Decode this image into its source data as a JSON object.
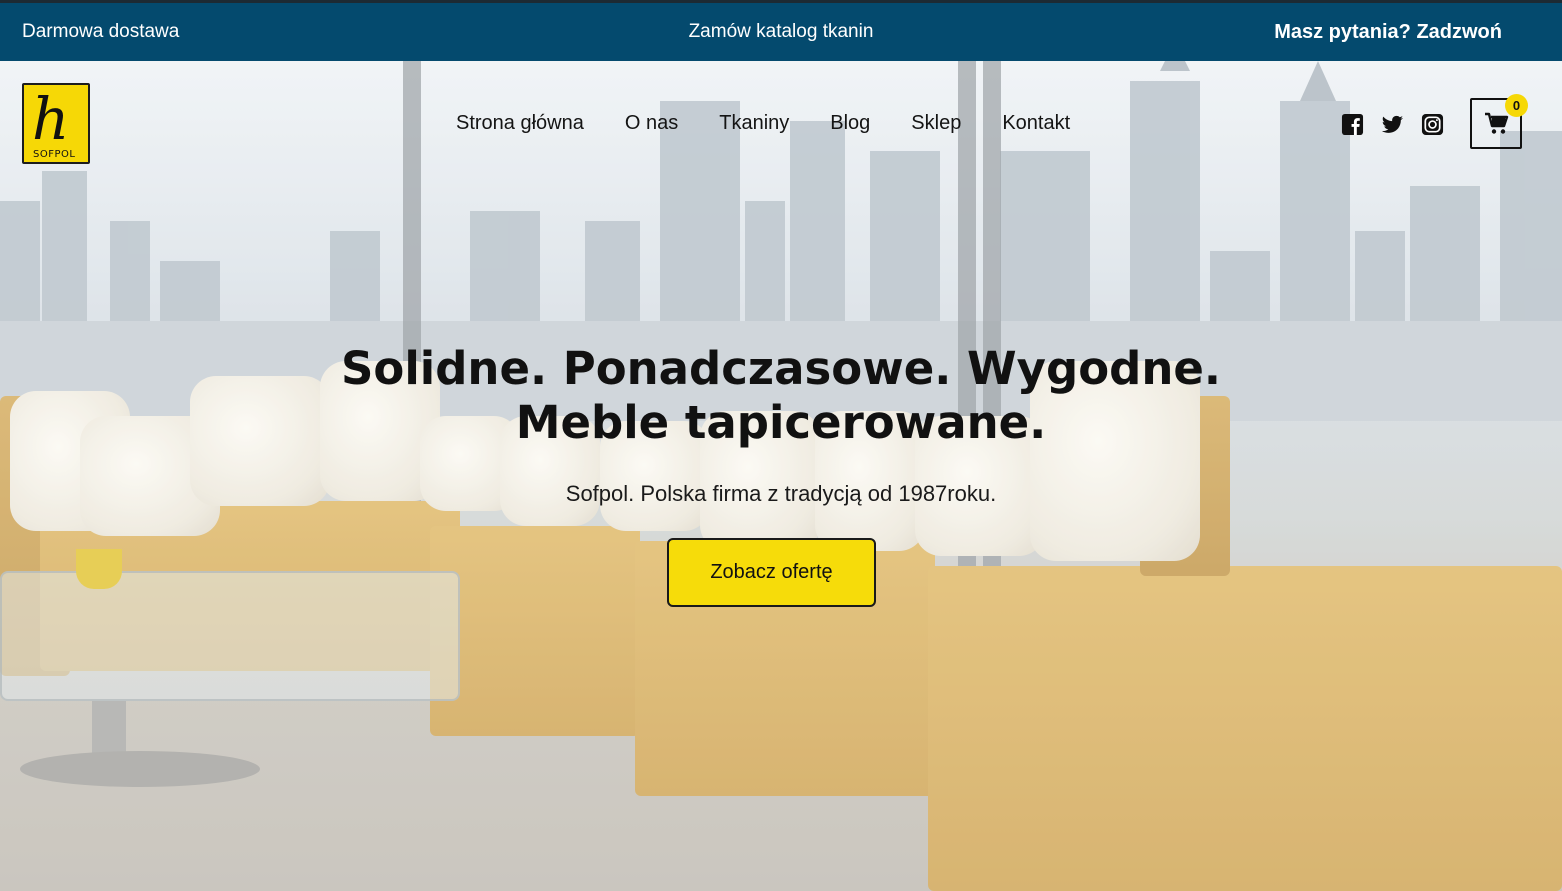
{
  "topbar": {
    "left_text": "Darmowa dostawa",
    "center_text": "Zamów katalog tkanin",
    "right_text": "Masz pytania? Zadzwoń"
  },
  "header": {
    "logo_text": "SOFPOL",
    "nav": [
      {
        "label": "Strona główna"
      },
      {
        "label": "O nas"
      },
      {
        "label": "Tkaniny"
      },
      {
        "label": "Blog"
      },
      {
        "label": "Sklep"
      },
      {
        "label": "Kontakt"
      }
    ],
    "social_icons": [
      "facebook-icon",
      "twitter-icon",
      "instagram-icon"
    ],
    "cart_count": "0"
  },
  "hero": {
    "headline_line1": "Solidne. Ponadczasowe. Wygodne.",
    "headline_line2": "Meble tapicerowane.",
    "subheadline": "Sofpol. Polska firma z tradycją od 1987roku.",
    "cta_label": "Zobacz ofertę"
  },
  "colors": {
    "topbar_bg": "#044a6e",
    "accent_yellow": "#f6dc0a",
    "text_dark": "#111111"
  }
}
